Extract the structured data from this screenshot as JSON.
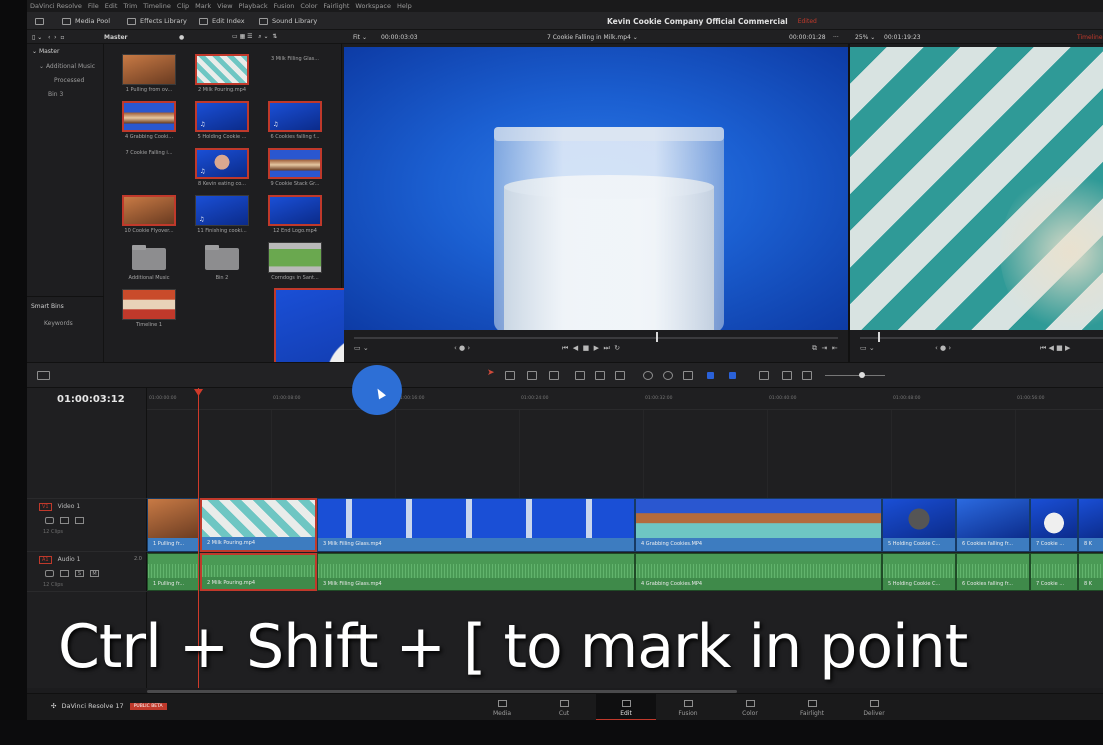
{
  "menu": [
    "DaVinci Resolve",
    "File",
    "Edit",
    "Trim",
    "Timeline",
    "Clip",
    "Mark",
    "View",
    "Playback",
    "Fusion",
    "Color",
    "Fairlight",
    "Workspace",
    "Help"
  ],
  "toolbar": {
    "media_pool": "Media Pool",
    "effects_library": "Effects Library",
    "edit_index": "Edit Index",
    "sound_library": "Sound Library",
    "project_title": "Kevin Cookie Company Official Commercial",
    "edited": "Edited"
  },
  "subbar": {
    "bin_title": "Master",
    "fit": "Fit",
    "source_timecode": "00:00:03:03",
    "source_clip": "7 Cookie Falling in Milk.mp4",
    "source_duration": "00:00:01:28",
    "zoom": "25%",
    "timeline_timecode": "00:01:19:23",
    "timeline_label": "Timeline"
  },
  "bins": {
    "master": "Master",
    "additional_music": "Additional Music",
    "processed": "Processed",
    "bin3": "Bin 3",
    "smart_bins": "Smart Bins",
    "keywords": "Keywords"
  },
  "clips": [
    {
      "label": "1 Pulling from ov..."
    },
    {
      "label": "2 Milk Pouring.mp4"
    },
    {
      "label": "3 Milk Filling Glas..."
    },
    {
      "label": "4 Grabbing Cooki..."
    },
    {
      "label": "5 Holding Cookie ..."
    },
    {
      "label": "6 Cookies falling f..."
    },
    {
      "label": "7 Cookie Falling i..."
    },
    {
      "label": "8 Kevin eating co..."
    },
    {
      "label": "9 Cookie Stack Gr..."
    },
    {
      "label": "10 Cookie Flyover..."
    },
    {
      "label": "11 Finishing cooki..."
    },
    {
      "label": "12 End Logo.mp4"
    },
    {
      "label": "Additional Music"
    },
    {
      "label": "Bin 2"
    },
    {
      "label": "Corndogs in Sant..."
    },
    {
      "label": "Timeline 1"
    }
  ],
  "timeline": {
    "timecode": "01:00:03:12",
    "ruler": [
      "01:00:00:00",
      "01:00:08:00",
      "01:00:16:00",
      "01:00:24:00",
      "01:00:32:00",
      "01:00:40:00",
      "01:00:48:00",
      "01:00:56:00"
    ],
    "video_track": {
      "tag": "V1",
      "name": "Video 1",
      "count": "12 Clips"
    },
    "audio_track": {
      "tag": "A1",
      "name": "Audio 1",
      "level": "2.0",
      "count": "12 Clips",
      "s": "S",
      "m": "M"
    },
    "video_clips": [
      "1 Pulling fr...",
      "2 Milk Pouring.mp4",
      "3 Milk Filling Glass.mp4",
      "4 Grabbing Cookies.MP4",
      "5 Holding Cookie C...",
      "6 Cookies falling fr...",
      "7 Cookie ...",
      "8 K"
    ],
    "audio_clips": [
      "1 Pulling fr...",
      "2 Milk Pouring.mp4",
      "3 Milk Filling Glass.mp4",
      "4 Grabbing Cookies.MP4",
      "5 Holding Cookie C...",
      "6 Cookies falling fr...",
      "7 Cookie ...",
      "8 K"
    ]
  },
  "caption": "Ctrl + Shift + [ to mark in point",
  "footer": {
    "app": "DaVinci Resolve 17",
    "beta": "PUBLIC BETA",
    "tabs": [
      "Media",
      "Cut",
      "Edit",
      "Fusion",
      "Color",
      "Fairlight",
      "Deliver"
    ]
  },
  "colors": {
    "accent_red": "#c0392b",
    "video_clip": "#3d7cc0",
    "audio_clip": "#4a9a55",
    "playhead": "#d03a2a"
  }
}
